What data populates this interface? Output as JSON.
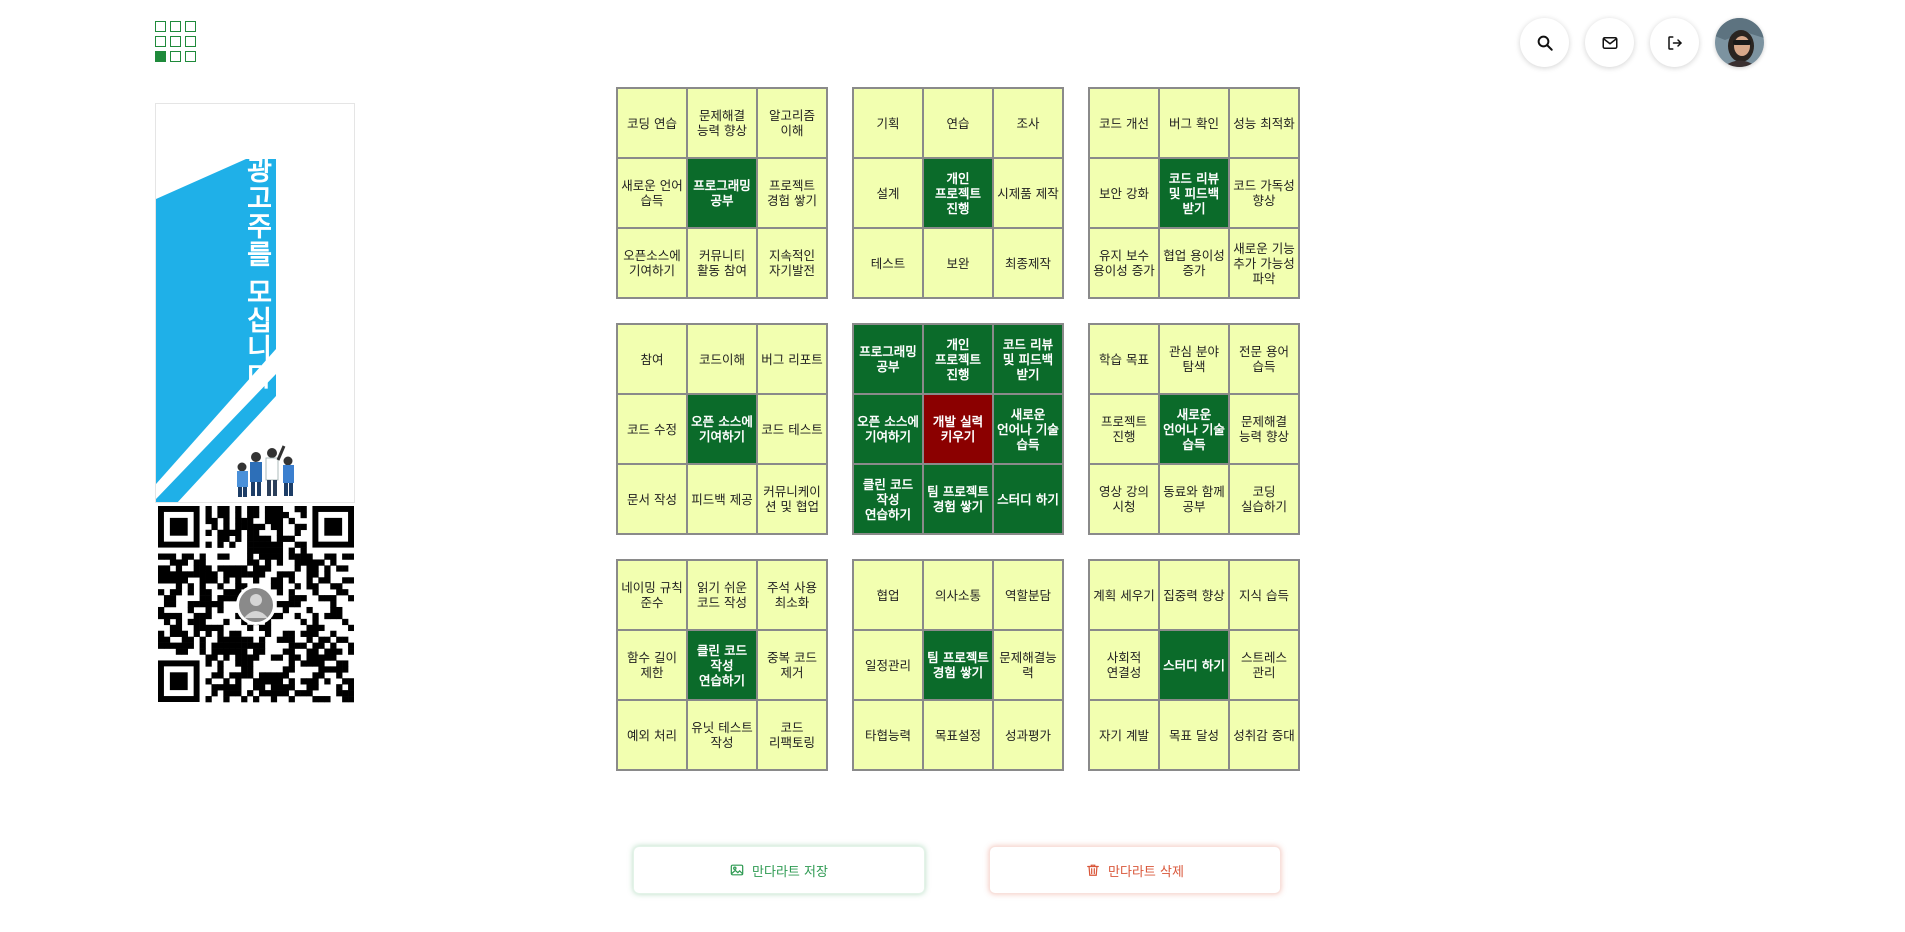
{
  "header": {
    "logo": "mandalart-grid-logo",
    "actions": [
      {
        "name": "search-button",
        "icon": "search-icon"
      },
      {
        "name": "mail-button",
        "icon": "mail-icon"
      },
      {
        "name": "logout-button",
        "icon": "logout-icon"
      }
    ],
    "avatar": "user-avatar"
  },
  "ad": {
    "text": "광고주를 모십니다",
    "accent_color": "#1fb0e8"
  },
  "mandala": {
    "colors": {
      "cell": "#f2ffb0",
      "sub_goal": "#0b6b2a",
      "core_goal": "#8b0000"
    },
    "blocks": [
      {
        "cells": [
          {
            "text": "코딩 연습",
            "type": "normal"
          },
          {
            "text": "문제해결 능력 향상",
            "type": "normal"
          },
          {
            "text": "알고리즘 이해",
            "type": "normal"
          },
          {
            "text": "새로운 언어 습득",
            "type": "normal"
          },
          {
            "text": "프로그래밍 공부",
            "type": "sub"
          },
          {
            "text": "프로젝트 경험 쌓기",
            "type": "normal"
          },
          {
            "text": "오픈소스에 기여하기",
            "type": "normal"
          },
          {
            "text": "커뮤니티 활동 참여",
            "type": "normal"
          },
          {
            "text": "지속적인 자기발전",
            "type": "normal"
          }
        ]
      },
      {
        "cells": [
          {
            "text": "기획",
            "type": "normal"
          },
          {
            "text": "연습",
            "type": "normal"
          },
          {
            "text": "조사",
            "type": "normal"
          },
          {
            "text": "설계",
            "type": "normal"
          },
          {
            "text": "개인 프로젝트 진행",
            "type": "sub"
          },
          {
            "text": "시제품 제작",
            "type": "normal"
          },
          {
            "text": "테스트",
            "type": "normal"
          },
          {
            "text": "보완",
            "type": "normal"
          },
          {
            "text": "최종제작",
            "type": "normal"
          }
        ]
      },
      {
        "cells": [
          {
            "text": "코드 개선",
            "type": "normal"
          },
          {
            "text": "버그 확인",
            "type": "normal"
          },
          {
            "text": "성능 최적화",
            "type": "normal"
          },
          {
            "text": "보안 강화",
            "type": "normal"
          },
          {
            "text": "코드 리뷰 및 피드백 받기",
            "type": "sub"
          },
          {
            "text": "코드 가독성 향상",
            "type": "normal"
          },
          {
            "text": "유지 보수 용이성 증가",
            "type": "normal"
          },
          {
            "text": "협업 용이성 증가",
            "type": "normal"
          },
          {
            "text": "새로운 기능 추가 가능성 파악",
            "type": "normal"
          }
        ]
      },
      {
        "cells": [
          {
            "text": "참여",
            "type": "normal"
          },
          {
            "text": "코드이해",
            "type": "normal"
          },
          {
            "text": "버그 리포트",
            "type": "normal"
          },
          {
            "text": "코드 수정",
            "type": "normal"
          },
          {
            "text": "오픈 소스에 기여하기",
            "type": "sub"
          },
          {
            "text": "코드 테스트",
            "type": "normal"
          },
          {
            "text": "문서 작성",
            "type": "normal"
          },
          {
            "text": "피드백 제공",
            "type": "normal"
          },
          {
            "text": "커뮤니케이션 및 협업",
            "type": "normal"
          }
        ]
      },
      {
        "cells": [
          {
            "text": "프로그래밍 공부",
            "type": "sub"
          },
          {
            "text": "개인 프로젝트 진행",
            "type": "sub"
          },
          {
            "text": "코드 리뷰 및 피드백 받기",
            "type": "sub"
          },
          {
            "text": "오픈 소스에 기여하기",
            "type": "sub"
          },
          {
            "text": "개발 실력 키우기",
            "type": "core"
          },
          {
            "text": "새로운 언어나 기술 습득",
            "type": "sub"
          },
          {
            "text": "클린 코드 작성 연습하기",
            "type": "sub"
          },
          {
            "text": "팀 프로젝트 경험 쌓기",
            "type": "sub"
          },
          {
            "text": "스터디 하기",
            "type": "sub"
          }
        ]
      },
      {
        "cells": [
          {
            "text": "학습 목표",
            "type": "normal"
          },
          {
            "text": "관심 분야 탐색",
            "type": "normal"
          },
          {
            "text": "전문 용어 습득",
            "type": "normal"
          },
          {
            "text": "프로젝트 진행",
            "type": "normal"
          },
          {
            "text": "새로운 언어나 기술 습득",
            "type": "sub"
          },
          {
            "text": "문제해결 능력 향상",
            "type": "normal"
          },
          {
            "text": "영상 강의 시청",
            "type": "normal"
          },
          {
            "text": "동료와 함께 공부",
            "type": "normal"
          },
          {
            "text": "코딩 실습하기",
            "type": "normal"
          }
        ]
      },
      {
        "cells": [
          {
            "text": "네이밍 규칙 준수",
            "type": "normal"
          },
          {
            "text": "읽기 쉬운 코드 작성",
            "type": "normal"
          },
          {
            "text": "주석 사용 최소화",
            "type": "normal"
          },
          {
            "text": "함수 길이 제한",
            "type": "normal"
          },
          {
            "text": "클린 코드 작성 연습하기",
            "type": "sub"
          },
          {
            "text": "중복 코드 제거",
            "type": "normal"
          },
          {
            "text": "예외 처리",
            "type": "normal"
          },
          {
            "text": "유닛 테스트 작성",
            "type": "normal"
          },
          {
            "text": "코드 리팩토링",
            "type": "normal"
          }
        ]
      },
      {
        "cells": [
          {
            "text": "협업",
            "type": "normal"
          },
          {
            "text": "의사소통",
            "type": "normal"
          },
          {
            "text": "역할분담",
            "type": "normal"
          },
          {
            "text": "일정관리",
            "type": "normal"
          },
          {
            "text": "팀 프로젝트 경험 쌓기",
            "type": "sub"
          },
          {
            "text": "문제해결능력",
            "type": "normal"
          },
          {
            "text": "타협능력",
            "type": "normal"
          },
          {
            "text": "목표설정",
            "type": "normal"
          },
          {
            "text": "성과평가",
            "type": "normal"
          }
        ]
      },
      {
        "cells": [
          {
            "text": "계획 세우기",
            "type": "normal"
          },
          {
            "text": "집중력 향상",
            "type": "normal"
          },
          {
            "text": "지식 습득",
            "type": "normal"
          },
          {
            "text": "사회적 연결성",
            "type": "normal"
          },
          {
            "text": "스터디 하기",
            "type": "sub"
          },
          {
            "text": "스트레스 관리",
            "type": "normal"
          },
          {
            "text": "자기 계발",
            "type": "normal"
          },
          {
            "text": "목표 달성",
            "type": "normal"
          },
          {
            "text": "성취감 증대",
            "type": "normal"
          }
        ]
      }
    ]
  },
  "actions": {
    "save_label": "만다라트 저장",
    "save_icon": "image-icon",
    "delete_label": "만다라트 삭제",
    "delete_icon": "trash-icon"
  }
}
